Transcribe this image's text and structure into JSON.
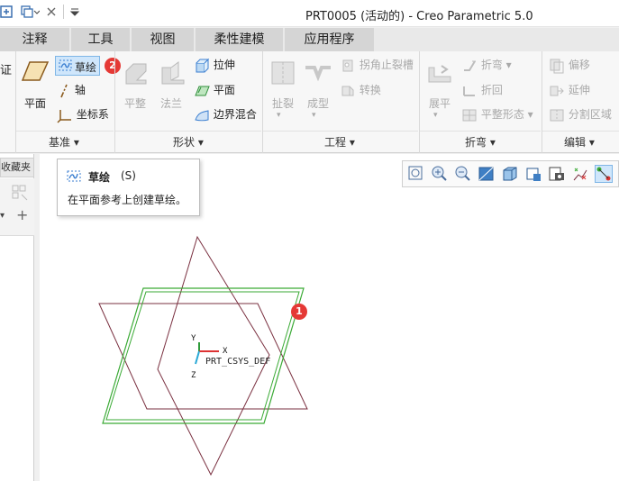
{
  "window": {
    "title": "PRT0005 (活动的) - Creo Parametric 5.0"
  },
  "tabs": [
    {
      "label": "注释"
    },
    {
      "label": "工具"
    },
    {
      "label": "视图"
    },
    {
      "label": "柔性建模"
    },
    {
      "label": "应用程序"
    }
  ],
  "ribbon": {
    "partial_label": "证",
    "datum": {
      "plane": "平面",
      "sketch": "草绘",
      "axis": "轴",
      "csys": "坐标系",
      "group_label": "基准"
    },
    "shapes": {
      "flatten": "平整",
      "flange": "法兰",
      "extrude": "拉伸",
      "plane": "平面",
      "blend": "边界混合",
      "group_label": "形状"
    },
    "engineering": {
      "rip": "扯裂",
      "form": "成型",
      "corner_relief": "拐角止裂槽",
      "convert": "转换",
      "group_label": "工程"
    },
    "bends": {
      "unbend": "展平",
      "bend": "折弯",
      "bend_back": "折回",
      "flat_pattern": "平整形态",
      "group_label": "折弯"
    },
    "editing": {
      "offset": "偏移",
      "extend": "延伸",
      "split": "分割区域",
      "group_label": "编辑"
    }
  },
  "left_panel": {
    "tab_label": "收藏夹"
  },
  "tooltip": {
    "title": "草绘",
    "shortcut": "(S)",
    "description": "在平面参考上创建草绘。"
  },
  "graphics": {
    "csys_label": "PRT_CSYS_DEF",
    "axis_x": "X",
    "axis_y": "Y",
    "axis_z": "Z"
  },
  "badges": {
    "sketch_badge": "2",
    "plane_badge": "1"
  },
  "colors": {
    "datum_plane": "#7a3040",
    "selected_plane": "#3aaa35",
    "badge": "#e53935"
  }
}
